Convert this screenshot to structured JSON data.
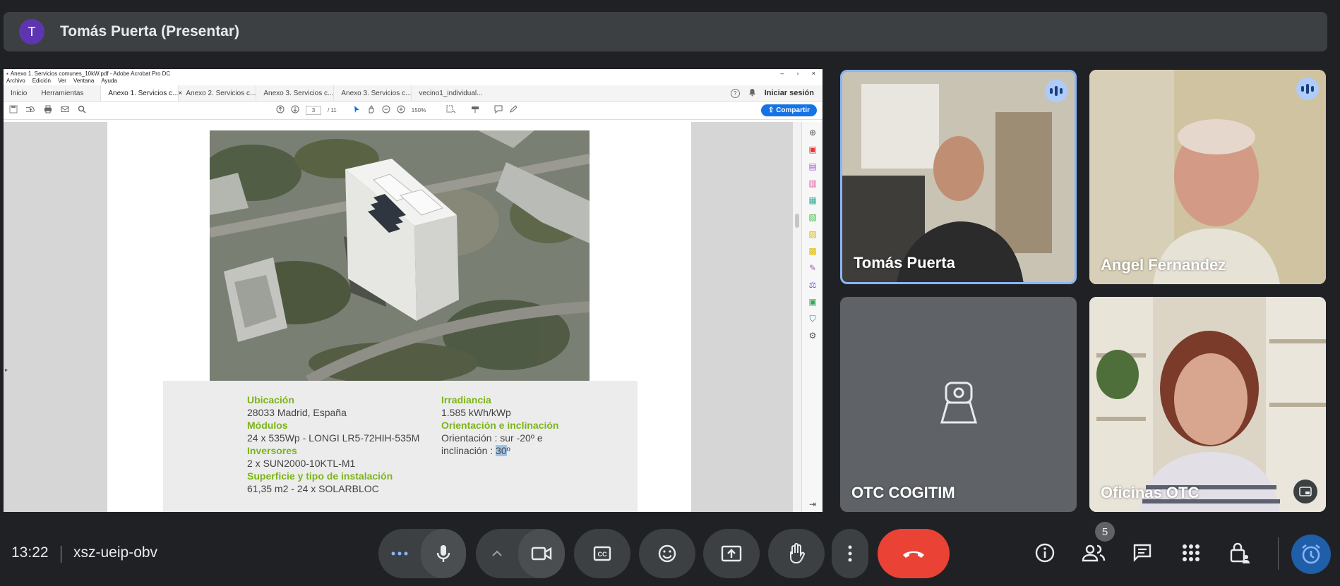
{
  "header": {
    "avatar_letter": "T",
    "presenter_title": "Tomás Puerta (Presentar)"
  },
  "acrobat": {
    "window_title": "Anexo 1. Servicios comunes_10kW.pdf - Adobe Acrobat Pro DC",
    "window_controls": [
      "–",
      "▫",
      "×"
    ],
    "menu": [
      "Archivo",
      "Edición",
      "Ver",
      "Ventana",
      "Ayuda"
    ],
    "nav_tabs": [
      "Inicio",
      "Herramientas"
    ],
    "doc_tabs": [
      {
        "label": "Anexo 1. Servicios c...",
        "active": true,
        "close": "×"
      },
      {
        "label": "Anexo 2. Servicios c...",
        "active": false
      },
      {
        "label": "Anexo 3. Servicios c...",
        "active": false
      },
      {
        "label": "Anexo 3. Servicios c...",
        "active": false
      },
      {
        "label": "vecino1_individual...",
        "active": false
      }
    ],
    "help_glyph": "?",
    "signin": "Iniciar sesión",
    "page_current": "3",
    "page_total": "/ 11",
    "zoom": "150%",
    "share_label": "Compartir"
  },
  "document": {
    "left_col": [
      {
        "label": "Ubicación",
        "value": "28033 Madrid, España"
      },
      {
        "label": "Módulos",
        "value": "24 x 535Wp - LONGI LR5-72HIH-535M"
      },
      {
        "label": "Inversores",
        "value": "2 x SUN2000-10KTL-M1"
      },
      {
        "label": "Superficie y tipo de instalación",
        "value": "61,35 m2 - 24 x SOLARBLOC"
      }
    ],
    "right_col": {
      "irr_label": "Irradiancia",
      "irr_value": "1.585 kWh/kWp",
      "orient_label": "Orientación e inclinación",
      "orient_line1": "Orientación : sur -20º e",
      "orient_line2_prefix": "inclinación : ",
      "orient_line2_highlight": "30",
      "orient_line2_suffix": "º"
    }
  },
  "participants": [
    {
      "name": "Tomás Puerta",
      "speaking": true
    },
    {
      "name": "Angel Fernandez",
      "speaking": true
    },
    {
      "name": "OTC COGITIM",
      "speaking": false
    },
    {
      "name": "Oficinas OTC",
      "speaking": false
    }
  ],
  "bottom": {
    "time": "13:22",
    "meeting_code": "xsz-ueip-obv",
    "participants_count": "5",
    "colors": {
      "end_call": "#ea4335",
      "control_bg": "#3c4043",
      "accent": "#8ab4f8",
      "doc_label_green": "#7cb518"
    }
  }
}
